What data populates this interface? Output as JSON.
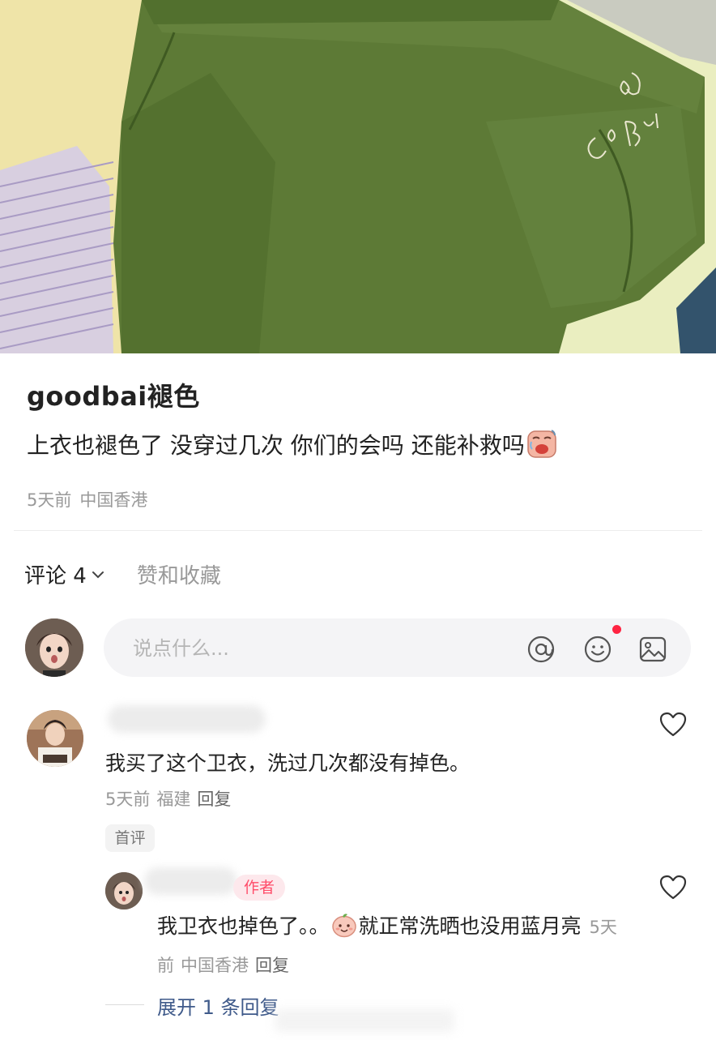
{
  "post": {
    "title": "goodbai褪色",
    "body": "上衣也褪色了 没穿过几次 你们的会吗 还能补救吗",
    "meta": {
      "time": "5天前",
      "location": "中国香港"
    },
    "photo_logo_text": "GoOD Bai"
  },
  "tabs": {
    "comments_label": "评论 4",
    "likes_label": "赞和收藏"
  },
  "comment_input": {
    "placeholder": "说点什么...",
    "icons": [
      "at-icon",
      "emoji-icon",
      "image-icon"
    ]
  },
  "comments": [
    {
      "text": "我买了这个卫衣，洗过几次都没有掉色。",
      "time": "5天前",
      "location": "福建",
      "reply_label": "回复",
      "badge": "首评",
      "replies": [
        {
          "author_tag": "作者",
          "text_before_emoji": "我卫衣也掉色了。。",
          "text_after_emoji": "就正常洗晒也没用蓝月亮",
          "time": "5天前",
          "location": "中国香港",
          "reply_label": "回复"
        }
      ],
      "expand_label": "展开 1 条回复"
    }
  ],
  "colors": {
    "accent_red": "#ff2442",
    "link_blue": "#3f5a8a",
    "meta_gray": "#999999"
  }
}
